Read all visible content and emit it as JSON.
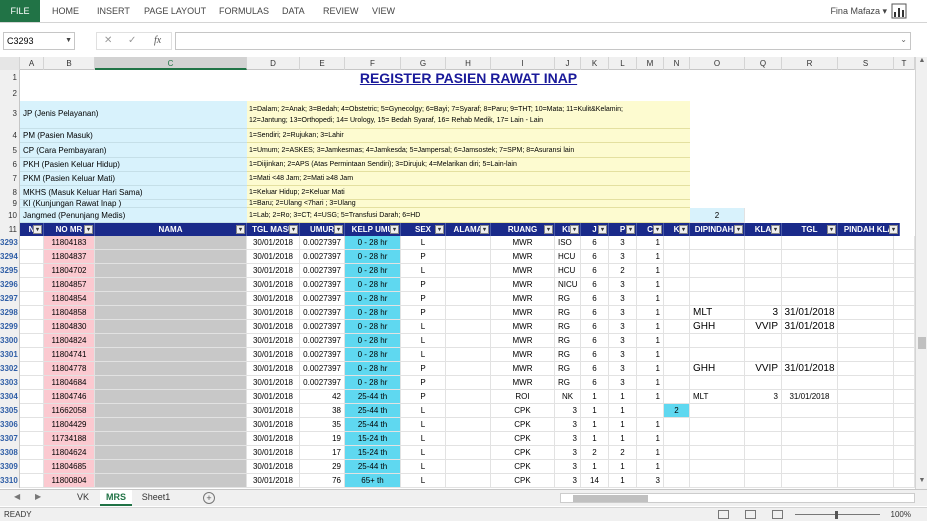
{
  "ribbon": {
    "file": "FILE",
    "tabs": [
      "HOME",
      "INSERT",
      "PAGE LAYOUT",
      "FORMULAS",
      "DATA",
      "REVIEW",
      "VIEW"
    ],
    "user": "Fina Mafaza"
  },
  "formula_bar": {
    "name_box": "C3293",
    "formula": ""
  },
  "columns": [
    "A",
    "B",
    "C",
    "D",
    "E",
    "F",
    "G",
    "H",
    "I",
    "J",
    "K",
    "L",
    "M",
    "N",
    "O",
    "Q",
    "R",
    "S",
    "T"
  ],
  "title": "REGISTER PASIEN RAWAT INAP",
  "legend": [
    {
      "row": "3",
      "label": "JP (Jenis Pelayanan)",
      "value_line1": "1=Dalam; 2=Anak; 3=Bedah; 4=Obstetric; 5=Gynecolgy; 6=Bayi; 7=Syaraf; 8=Paru; 9=THT; 10=Mata; 11=Kulit&Kelamin;",
      "value_line2": "12=Jantung; 13=Orthopedi; 14= Urology, 15= Bedah Syaraf, 16= Rehab Medik, 17= Lain - Lain"
    },
    {
      "row": "4",
      "label": "PM (Pasien Masuk)",
      "value_line1": "1=Sendiri; 2=Rujukan; 3=Lahir",
      "value_line2": ""
    },
    {
      "row": "5",
      "label": "CP (Cara Pembayaran)",
      "value_line1": "1=Umum; 2=ASKES; 3=Jamkesmas; 4=Jamkesda; 5=Jampersal; 6=Jamsostek; 7=SPM; 8=Asuransi lain",
      "value_line2": ""
    },
    {
      "row": "6",
      "label": "PKH (Pasien Keluar Hidup)",
      "value_line1": "1=Diijinkan; 2=APS (Atas Permintaan Sendiri); 3=Dirujuk; 4=Melarikan diri; 5=Lain-lain",
      "value_line2": ""
    },
    {
      "row": "7",
      "label": "PKM (Pasien Keluar Mati)",
      "value_line1": "1=Mati <48 Jam; 2=Mati ≥48 Jam",
      "value_line2": ""
    },
    {
      "row": "8",
      "label": "MKHS (Masuk Keluar Hari Sama)",
      "value_line1": "1=Keluar Hidup; 2=Keluar Mati",
      "value_line2": ""
    },
    {
      "row": "9",
      "label": "KI (Kunjungan Rawat Inap )",
      "value_line1": "1=Baru; 2=Ulang <7hari ; 3=Ulang",
      "value_line2": ""
    },
    {
      "row": "10",
      "label": "Jangmed (Penunjang Medis)",
      "value_line1": "1=Lab; 2=Ro; 3=CT; 4=USG; 5=Transfusi Darah; 6=HD",
      "value_line2": ""
    }
  ],
  "row10_q": "2",
  "headers": [
    "N",
    "NO MR",
    "NAMA",
    "TGL MASU",
    "UMUR",
    "KELP UMU",
    "SEX",
    "ALAMA",
    "RUANG",
    "KL",
    "J",
    "P",
    "C",
    "K",
    "DIPINDAHK",
    "KLA",
    "TGL",
    "PINDAH KLA"
  ],
  "rows": [
    {
      "n": "3293",
      "mr": "11804183",
      "tgl": "30/01/2018",
      "umur": "0.0027397",
      "kelp": "0 - 28 hr",
      "sex": "L",
      "ruang": "MWR",
      "kl": "ISO",
      "j": "6",
      "p": "3",
      "c": "1",
      "m": "",
      "q": "",
      "r": "",
      "s": ""
    },
    {
      "n": "3294",
      "mr": "11804837",
      "tgl": "30/01/2018",
      "umur": "0.0027397",
      "kelp": "0 - 28 hr",
      "sex": "P",
      "ruang": "MWR",
      "kl": "HCU",
      "j": "6",
      "p": "3",
      "c": "1",
      "m": "",
      "q": "",
      "r": "",
      "s": ""
    },
    {
      "n": "3295",
      "mr": "11804702",
      "tgl": "30/01/2018",
      "umur": "0.0027397",
      "kelp": "0 - 28 hr",
      "sex": "L",
      "ruang": "MWR",
      "kl": "HCU",
      "j": "6",
      "p": "2",
      "c": "1",
      "m": "",
      "q": "",
      "r": "",
      "s": ""
    },
    {
      "n": "3296",
      "mr": "11804857",
      "tgl": "30/01/2018",
      "umur": "0.0027397",
      "kelp": "0 - 28 hr",
      "sex": "P",
      "ruang": "MWR",
      "kl": "NICU",
      "j": "6",
      "p": "3",
      "c": "1",
      "m": "",
      "q": "",
      "r": "",
      "s": ""
    },
    {
      "n": "3297",
      "mr": "11804854",
      "tgl": "30/01/2018",
      "umur": "0.0027397",
      "kelp": "0 - 28 hr",
      "sex": "P",
      "ruang": "MWR",
      "kl": "RG",
      "j": "6",
      "p": "3",
      "c": "1",
      "m": "",
      "q": "",
      "r": "",
      "s": ""
    },
    {
      "n": "3298",
      "mr": "11804858",
      "tgl": "30/01/2018",
      "umur": "0.0027397",
      "kelp": "0 - 28 hr",
      "sex": "P",
      "ruang": "MWR",
      "kl": "RG",
      "j": "6",
      "p": "3",
      "c": "1",
      "m": "",
      "q": "MLT",
      "r": "3",
      "s": "31/01/2018"
    },
    {
      "n": "3299",
      "mr": "11804830",
      "tgl": "30/01/2018",
      "umur": "0.0027397",
      "kelp": "0 - 28 hr",
      "sex": "L",
      "ruang": "MWR",
      "kl": "RG",
      "j": "6",
      "p": "3",
      "c": "1",
      "m": "",
      "q": "GHH",
      "r": "VVIP",
      "s": "31/01/2018"
    },
    {
      "n": "3300",
      "mr": "11804824",
      "tgl": "30/01/2018",
      "umur": "0.0027397",
      "kelp": "0 - 28 hr",
      "sex": "L",
      "ruang": "MWR",
      "kl": "RG",
      "j": "6",
      "p": "3",
      "c": "1",
      "m": "",
      "q": "",
      "r": "",
      "s": ""
    },
    {
      "n": "3301",
      "mr": "11804741",
      "tgl": "30/01/2018",
      "umur": "0.0027397",
      "kelp": "0 - 28 hr",
      "sex": "L",
      "ruang": "MWR",
      "kl": "RG",
      "j": "6",
      "p": "3",
      "c": "1",
      "m": "",
      "q": "",
      "r": "",
      "s": ""
    },
    {
      "n": "3302",
      "mr": "11804778",
      "tgl": "30/01/2018",
      "umur": "0.0027397",
      "kelp": "0 - 28 hr",
      "sex": "P",
      "ruang": "MWR",
      "kl": "RG",
      "j": "6",
      "p": "3",
      "c": "1",
      "m": "",
      "q": "GHH",
      "r": "VVIP",
      "s": "31/01/2018"
    },
    {
      "n": "3303",
      "mr": "11804684",
      "tgl": "30/01/2018",
      "umur": "0.0027397",
      "kelp": "0 - 28 hr",
      "sex": "P",
      "ruang": "MWR",
      "kl": "RG",
      "j": "6",
      "p": "3",
      "c": "1",
      "m": "",
      "q": "",
      "r": "",
      "s": ""
    },
    {
      "n": "3304",
      "mr": "11804746",
      "tgl": "30/01/2018",
      "umur": "42",
      "kelp": "25-44 th",
      "sex": "P",
      "ruang": "ROI",
      "kl": "NK",
      "j": "1",
      "p": "1",
      "c": "1",
      "m": "",
      "q": "MLT",
      "r": "3",
      "s": "31/01/2018"
    },
    {
      "n": "3305",
      "mr": "11662058",
      "tgl": "30/01/2018",
      "umur": "38",
      "kelp": "25-44 th",
      "sex": "L",
      "ruang": "CPK",
      "kl": "3",
      "j": "1",
      "p": "1",
      "c": "",
      "m": "2",
      "q": "",
      "r": "",
      "s": ""
    },
    {
      "n": "3306",
      "mr": "11804429",
      "tgl": "30/01/2018",
      "umur": "35",
      "kelp": "25-44 th",
      "sex": "L",
      "ruang": "CPK",
      "kl": "3",
      "j": "1",
      "p": "1",
      "c": "1",
      "m": "",
      "q": "",
      "r": "",
      "s": ""
    },
    {
      "n": "3307",
      "mr": "11734188",
      "tgl": "30/01/2018",
      "umur": "19",
      "kelp": "15-24 th",
      "sex": "L",
      "ruang": "CPK",
      "kl": "3",
      "j": "1",
      "p": "1",
      "c": "1",
      "m": "",
      "q": "",
      "r": "",
      "s": ""
    },
    {
      "n": "3308",
      "mr": "11804624",
      "tgl": "30/01/2018",
      "umur": "17",
      "kelp": "15-24 th",
      "sex": "L",
      "ruang": "CPK",
      "kl": "3",
      "j": "2",
      "p": "2",
      "c": "1",
      "m": "",
      "q": "",
      "r": "",
      "s": ""
    },
    {
      "n": "3309",
      "mr": "11804685",
      "tgl": "30/01/2018",
      "umur": "29",
      "kelp": "25-44 th",
      "sex": "L",
      "ruang": "CPK",
      "kl": "3",
      "j": "1",
      "p": "1",
      "c": "1",
      "m": "",
      "q": "",
      "r": "",
      "s": ""
    },
    {
      "n": "3310",
      "mr": "11800804",
      "tgl": "30/01/2018",
      "umur": "76",
      "kelp": "65+ th",
      "sex": "L",
      "ruang": "CPK",
      "kl": "3",
      "j": "14",
      "p": "1",
      "c": "3",
      "m": "",
      "q": "",
      "r": "",
      "s": ""
    }
  ],
  "sheets": [
    "VK",
    "MRS",
    "Sheet1"
  ],
  "active_sheet": "MRS",
  "status": {
    "ready": "READY",
    "zoom": "100%"
  },
  "colors": {
    "header_bg": "#1a2a8a",
    "nomr_bg": "#fbc9d0",
    "kelp_bg": "#5fd8f0",
    "legend_label_bg": "#d8f2fc",
    "legend_value_bg": "#fdfbd0",
    "title": "#1a1a9a",
    "excel_green": "#217346"
  }
}
